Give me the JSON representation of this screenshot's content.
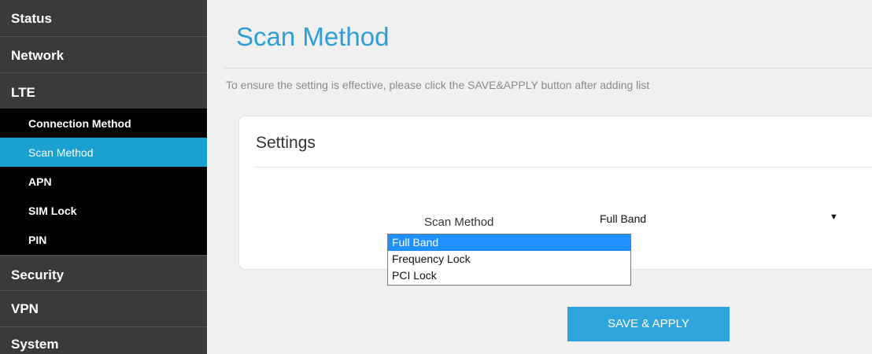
{
  "sidebar": {
    "top_items": [
      {
        "label": "Status"
      },
      {
        "label": "Network"
      },
      {
        "label": "LTE"
      }
    ],
    "lte_sub_items": [
      {
        "label": "Connection Method",
        "active": false
      },
      {
        "label": "Scan Method",
        "active": true
      },
      {
        "label": "APN",
        "active": false
      },
      {
        "label": "SIM Lock",
        "active": false
      },
      {
        "label": "PIN",
        "active": false
      }
    ],
    "bottom_items": [
      {
        "label": "Security"
      },
      {
        "label": "VPN"
      },
      {
        "label": "System"
      }
    ]
  },
  "page": {
    "title": "Scan Method",
    "hint": "To ensure the setting is effective, please click the SAVE&APPLY button after adding list"
  },
  "settings": {
    "title": "Settings",
    "field_label": "Scan Method",
    "selected_value": "Full Band",
    "options": [
      "Full Band",
      "Frequency Lock",
      "PCI Lock"
    ],
    "highlighted_option": 0
  },
  "actions": {
    "save_label": "SAVE & APPLY"
  },
  "colors": {
    "accent": "#2ea6dd",
    "sidebar_bg": "#3a3a3a",
    "submenu_bg": "#000000",
    "active_item": "#1ba1cf",
    "option_highlight": "#1e90ff"
  }
}
